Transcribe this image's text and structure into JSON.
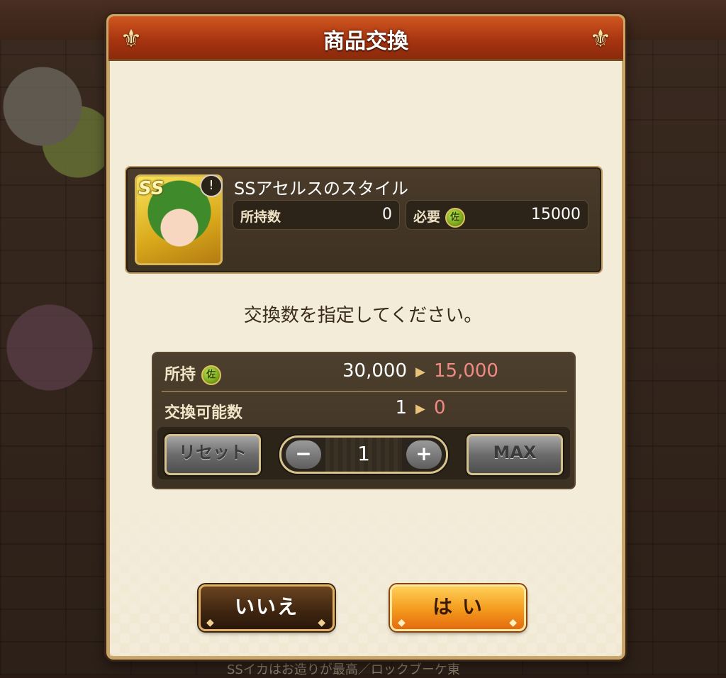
{
  "background": {
    "bottom_text": "SSイカはお造りが最高／ロックブーケ東"
  },
  "dialog": {
    "title": "商品交換",
    "item": {
      "name": "SSアセルスのスタイル",
      "rank_badge": "SS",
      "weapon_icon": "sword-icon",
      "owned_label": "所持数",
      "owned_value": "0",
      "required_label": "必要",
      "required_value": "15000",
      "currency_icon": "coin-icon",
      "currency_glyph": "佐"
    },
    "prompt": "交換数を指定してください。",
    "quantity": {
      "holding_label": "所持",
      "holding_before": "30,000",
      "holding_after": "15,000",
      "exchangeable_label": "交換可能数",
      "exchangeable_before": "1",
      "exchangeable_after": "0",
      "reset_label": "リセット",
      "minus_label": "−",
      "value": "1",
      "plus_label": "+",
      "max_label": "MAX"
    },
    "buttons": {
      "no_label": "いいえ",
      "yes_label": "は い"
    }
  },
  "colors": {
    "title_bar": "#a53310",
    "after_value": "#f08a84",
    "yes_button": "#f39a1c"
  }
}
